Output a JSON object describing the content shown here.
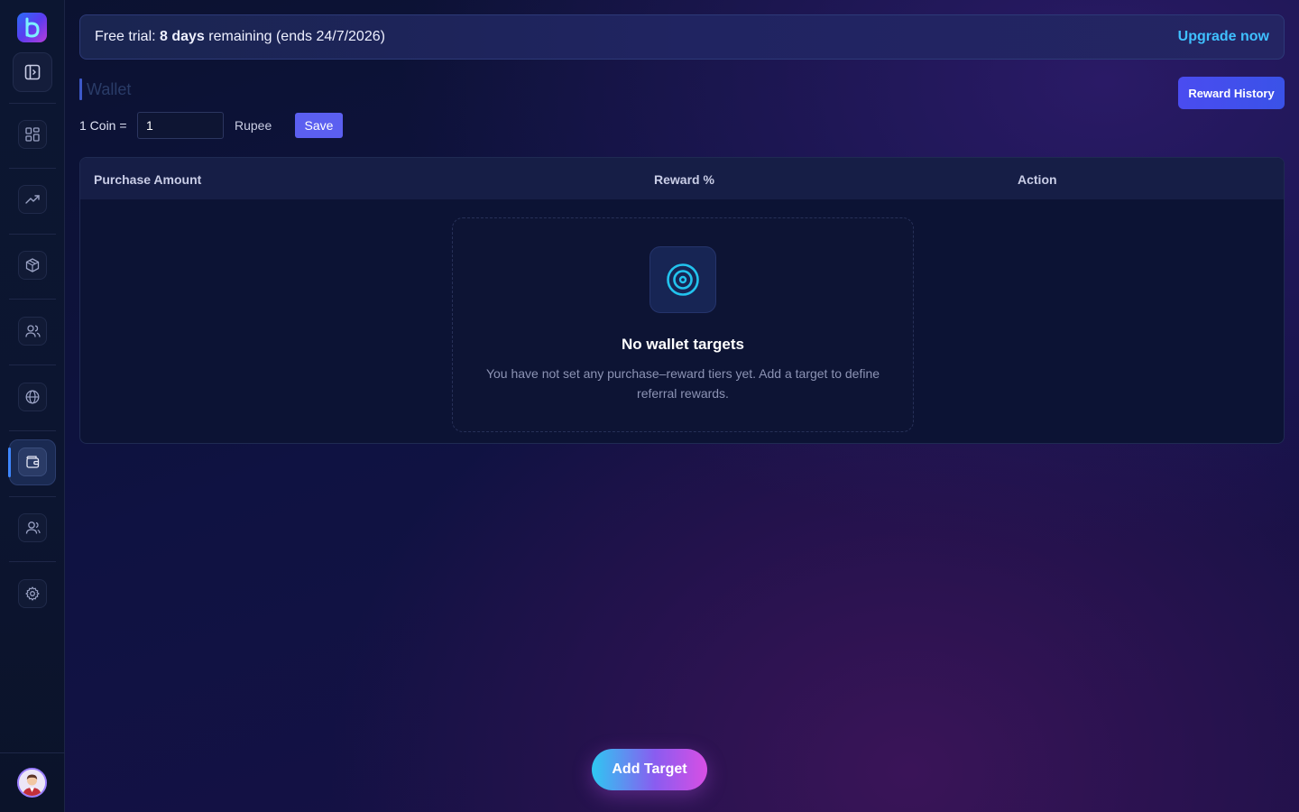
{
  "banner": {
    "prefix": "Free trial: ",
    "days": "8 days",
    "suffix": " remaining (ends 24/7/2026)",
    "upgrade_label": "Upgrade now"
  },
  "page": {
    "title": "Wallet",
    "reward_history_label": "Reward History"
  },
  "coin": {
    "label": "1 Coin =",
    "value": "1",
    "unit": "Rupee",
    "save_label": "Save"
  },
  "table": {
    "columns": [
      "Purchase Amount",
      "Reward %",
      "Action"
    ],
    "empty": {
      "title": "No wallet targets",
      "description": "You have not set any purchase–reward tiers yet. Add a target to define referral rewards."
    }
  },
  "actions": {
    "add_target_label": "Add Target"
  },
  "sidebar": {
    "items": [
      {
        "icon": "dashboard-icon"
      },
      {
        "icon": "trending-up-icon"
      },
      {
        "icon": "package-icon"
      },
      {
        "icon": "users-icon"
      },
      {
        "icon": "globe-icon"
      },
      {
        "icon": "wallet-icon",
        "active": true
      },
      {
        "icon": "user-group-icon"
      },
      {
        "icon": "settings-icon"
      }
    ]
  },
  "colors": {
    "accent": "#5b5ff0",
    "link": "#3fc0ff",
    "active_indicator": "#3e86ff"
  }
}
